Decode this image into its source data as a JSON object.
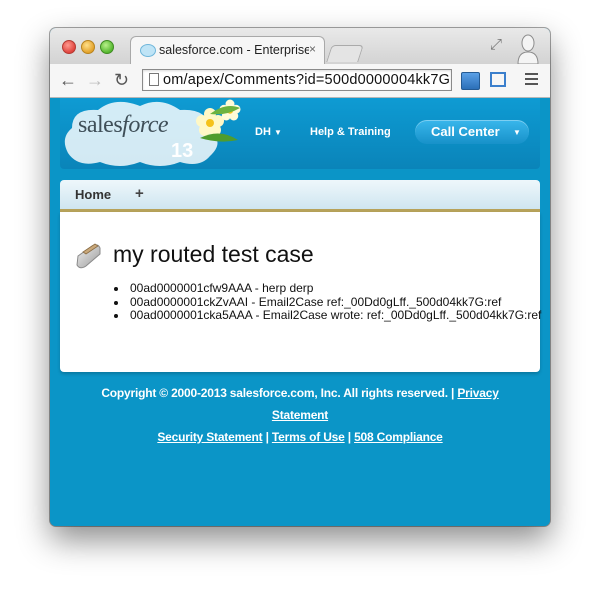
{
  "browser": {
    "tab_title": "salesforce.com - Enterprise",
    "tab_close": "×",
    "url": "om/apex/Comments?id=500d0000004kk7G"
  },
  "header": {
    "logo_sales": "sales",
    "logo_force": "force",
    "release": "13",
    "user_label": "DH",
    "help_label": "Help & Training",
    "call_center_label": "Call Center"
  },
  "tabs": {
    "home": "Home",
    "plus": "+"
  },
  "page": {
    "title": "my routed test case",
    "comments": [
      {
        "text": "00ad0000001cfw9AAA - herp derp"
      },
      {
        "text": "00ad0000001ckZvAAI - Email2Case ref:_00Dd0gLff._500d04kk7G:ref"
      },
      {
        "text": "00ad0000001cka5AAA - Email2Case wrote: ref:_00Dd0gLff._500d04kk7G:ref"
      }
    ]
  },
  "footer": {
    "copyright": "Copyright © 2000-2013 salesforce.com, Inc. All rights reserved.",
    "privacy": "Privacy Statement",
    "security": "Security Statement",
    "terms": "Terms of Use",
    "compliance": "508 Compliance"
  },
  "colors": {
    "brand_blue": "#0b95c7",
    "call_center": "#1791c9",
    "tab_divider": "#b7a25a"
  }
}
